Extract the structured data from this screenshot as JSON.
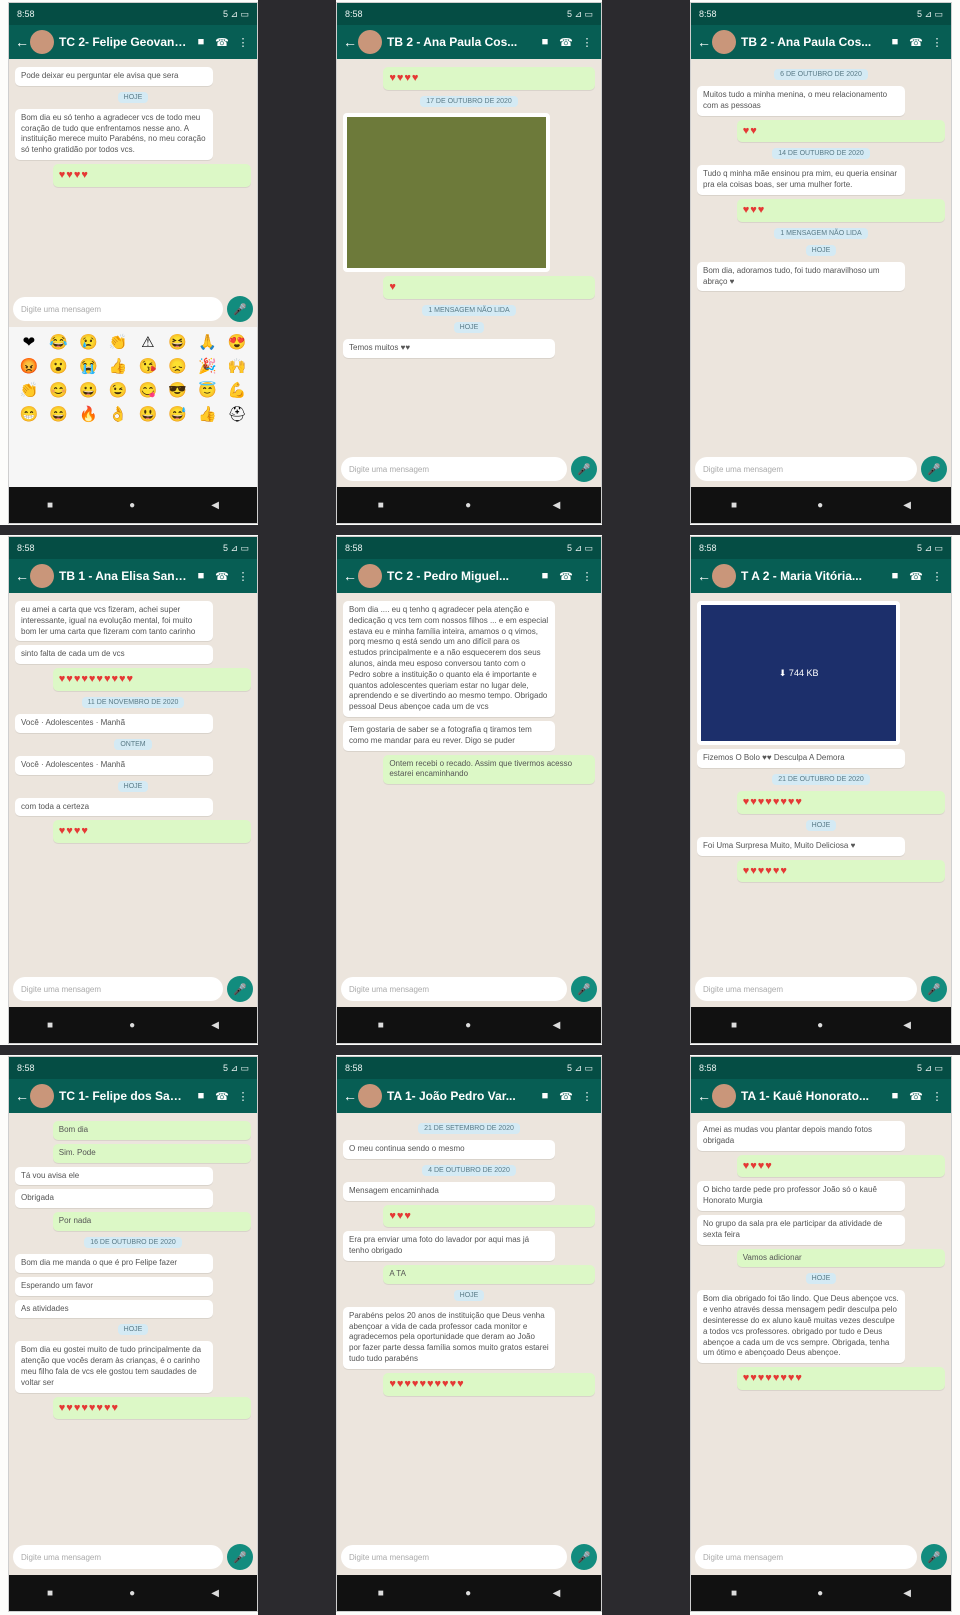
{
  "status": {
    "time": "8:58",
    "battery": "5 ⊿ ▭"
  },
  "phones": [
    {
      "title": "TC 2- Felipe Geovane...",
      "bubbles": [
        {
          "dir": "in",
          "text": "Pode deixar eu perguntar ele avisa que sera"
        },
        {
          "dir": "date",
          "text": "HOJE"
        },
        {
          "dir": "in",
          "text": "Bom dia eu só tenho a agradecer vcs de todo meu coração de tudo que enfrentamos nesse ano. A instituição merece muito Parabéns, no meu coração só tenho gratidão por todos vcs."
        },
        {
          "dir": "out",
          "text": "♥♥♥♥"
        }
      ]
    },
    {
      "title": "TB 2 - Ana Paula Cos...",
      "bubbles": [
        {
          "dir": "out",
          "text": "♥♥♥♥"
        },
        {
          "dir": "date",
          "text": "17 DE OUTUBRO DE 2020"
        },
        {
          "dir": "media",
          "text": ""
        },
        {
          "dir": "out",
          "text": "♥"
        },
        {
          "dir": "date",
          "text": "1 MENSAGEM NÃO LIDA"
        },
        {
          "dir": "date",
          "text": "HOJE"
        },
        {
          "dir": "in",
          "text": "Temos muitos ♥♥"
        }
      ]
    },
    {
      "title": "TB 2 - Ana Paula Cos...",
      "bubbles": [
        {
          "dir": "date",
          "text": "6 DE OUTUBRO DE 2020"
        },
        {
          "dir": "in",
          "text": "Muitos tudo a minha menina, o meu relacionamento com as pessoas"
        },
        {
          "dir": "out",
          "text": "♥♥"
        },
        {
          "dir": "date",
          "text": "14 DE OUTUBRO DE 2020"
        },
        {
          "dir": "in",
          "text": "Tudo q minha mãe ensinou pra mim, eu queria ensinar pra ela coisas boas, ser uma mulher forte."
        },
        {
          "dir": "out",
          "text": "♥♥♥"
        },
        {
          "dir": "date",
          "text": "1 MENSAGEM NÃO LIDA"
        },
        {
          "dir": "date",
          "text": "HOJE"
        },
        {
          "dir": "in",
          "text": "Bom dia, adoramos tudo, foi tudo maravilhoso um abraço ♥"
        }
      ]
    },
    {
      "title": "TB 1 - Ana Elisa Sant...",
      "bubbles": [
        {
          "dir": "in",
          "text": "eu amei a carta que vcs fizeram, achei super interessante, igual na evolução mental, foi muito bom ler uma carta que fizeram com tanto carinho"
        },
        {
          "dir": "in",
          "text": "sinto falta de cada um de vcs"
        },
        {
          "dir": "out",
          "text": "♥♥♥♥♥♥♥♥♥♥"
        },
        {
          "dir": "date",
          "text": "11 DE NOVEMBRO DE 2020"
        },
        {
          "dir": "in",
          "text": "Você · Adolescentes · Manhã"
        },
        {
          "dir": "date",
          "text": "ONTEM"
        },
        {
          "dir": "in",
          "text": "Você · Adolescentes · Manhã"
        },
        {
          "dir": "date",
          "text": "HOJE"
        },
        {
          "dir": "in",
          "text": "com toda a certeza"
        },
        {
          "dir": "out",
          "text": "♥♥♥♥"
        }
      ]
    },
    {
      "title": "TC 2 - Pedro Miguel...",
      "bubbles": [
        {
          "dir": "in",
          "text": "Bom dia .... eu q tenho q agradecer pela atenção e dedicação q vcs tem com nossos filhos ... e em especial estava eu e minha família inteira, amamos o q vimos, porq mesmo q está sendo um ano difícil para os estudos principalmente e a não esquecerem dos seus alunos, ainda meu esposo conversou tanto com o Pedro sobre a instituição o quanto ela é importante e quantos adolescentes queriam estar no lugar dele, aprendendo e se divertindo ao mesmo tempo. Obrigado pessoal Deus abençoe cada um de vcs"
        },
        {
          "dir": "in",
          "text": "Tem gostaria de saber se a fotografia q tiramos tem como me mandar para eu rever. Digo se puder"
        },
        {
          "dir": "out",
          "text": "Ontem recebi o recado. Assim que tivermos acesso estarei encaminhando"
        }
      ]
    },
    {
      "title": "T A 2 - Maria Vitória...",
      "bubbles": [
        {
          "dir": "media-dark",
          "text": "⬇ 744 KB"
        },
        {
          "dir": "in",
          "text": "Fizemos O Bolo ♥♥ Desculpa A Demora"
        },
        {
          "dir": "date",
          "text": "21 DE OUTUBRO DE 2020"
        },
        {
          "dir": "out",
          "text": "♥♥♥♥♥♥♥♥"
        },
        {
          "dir": "date",
          "text": "HOJE"
        },
        {
          "dir": "in",
          "text": "Foi Uma Surpresa Muito, Muito Deliciosa ♥"
        },
        {
          "dir": "out",
          "text": "♥♥♥♥♥♥"
        }
      ]
    },
    {
      "title": "TC 1- Felipe dos Sant...",
      "bubbles": [
        {
          "dir": "out",
          "text": "Bom dia"
        },
        {
          "dir": "out",
          "text": "Sim. Pode"
        },
        {
          "dir": "in",
          "text": "Tá vou avisa ele"
        },
        {
          "dir": "in",
          "text": "Obrigada"
        },
        {
          "dir": "out",
          "text": "Por nada"
        },
        {
          "dir": "date",
          "text": "16 DE OUTUBRO DE 2020"
        },
        {
          "dir": "in",
          "text": "Bom dia me manda o que é pro Felipe fazer"
        },
        {
          "dir": "in",
          "text": "Esperando um favor"
        },
        {
          "dir": "in",
          "text": "As atividades"
        },
        {
          "dir": "date",
          "text": "HOJE"
        },
        {
          "dir": "in",
          "text": "Bom dia eu gostei muito de tudo principalmente da atenção que vocês deram às crianças, é o carinho meu filho fala de vcs ele gostou tem saudades de voltar ser"
        },
        {
          "dir": "out",
          "text": "♥♥♥♥♥♥♥♥"
        }
      ]
    },
    {
      "title": "TA 1- João Pedro Var...",
      "bubbles": [
        {
          "dir": "date",
          "text": "21 DE SETEMBRO DE 2020"
        },
        {
          "dir": "in",
          "text": "O meu continua sendo o mesmo"
        },
        {
          "dir": "date",
          "text": "4 DE OUTUBRO DE 2020"
        },
        {
          "dir": "in",
          "text": "Mensagem encaminhada"
        },
        {
          "dir": "out",
          "text": "♥♥♥"
        },
        {
          "dir": "in",
          "text": "Era pra enviar uma foto do lavador por aqui mas já tenho obrigado"
        },
        {
          "dir": "out",
          "text": "A TA"
        },
        {
          "dir": "date",
          "text": "HOJE"
        },
        {
          "dir": "in",
          "text": "Parabéns pelos 20 anos de instituição que Deus venha abençoar a vida de cada professor cada monitor e agradecemos pela oportunidade que deram ao João por fazer parte dessa família somos muito gratos estarei tudo tudo parabéns"
        },
        {
          "dir": "out",
          "text": "♥♥♥♥♥♥♥♥♥♥"
        }
      ]
    },
    {
      "title": "TA 1- Kauê Honorato...",
      "bubbles": [
        {
          "dir": "in",
          "text": "Amei as mudas vou plantar depois mando fotos obrigada"
        },
        {
          "dir": "out",
          "text": "♥♥♥♥"
        },
        {
          "dir": "in",
          "text": "O bicho tarde pede pro professor João só o kauê Honorato Murgia"
        },
        {
          "dir": "in",
          "text": "No grupo da sala pra ele participar da atividade de sexta feira"
        },
        {
          "dir": "out",
          "text": "Vamos adicionar"
        },
        {
          "dir": "date",
          "text": "HOJE"
        },
        {
          "dir": "in",
          "text": "Bom dia obrigado foi tão lindo. Que Deus abençoe vcs. e venho através dessa mensagem pedir desculpa pelo desinteresse do ex aluno kauê muitas vezes desculpe a todos vcs professores. obrigado por tudo e Deus abençoe a cada um de vcs sempre. Obrigada, tenha um ótimo e abençoado Deus abençoe."
        },
        {
          "dir": "out",
          "text": "♥♥♥♥♥♥♥♥"
        }
      ]
    }
  ],
  "input": {
    "placeholder": "Digite uma mensagem"
  },
  "emoji": [
    "❤",
    "😂",
    "😢",
    "👏",
    "⚠",
    "😆",
    "🙏",
    "😍",
    "😡",
    "😮",
    "😭",
    "👍",
    "😘",
    "😞",
    "🎉",
    "🙌",
    "👏",
    "😊",
    "😀",
    "😉",
    "😋",
    "😎",
    "😇",
    "💪",
    "😁",
    "😄",
    "🔥",
    "👌",
    "😃",
    "😅",
    "👍",
    "⛑"
  ]
}
